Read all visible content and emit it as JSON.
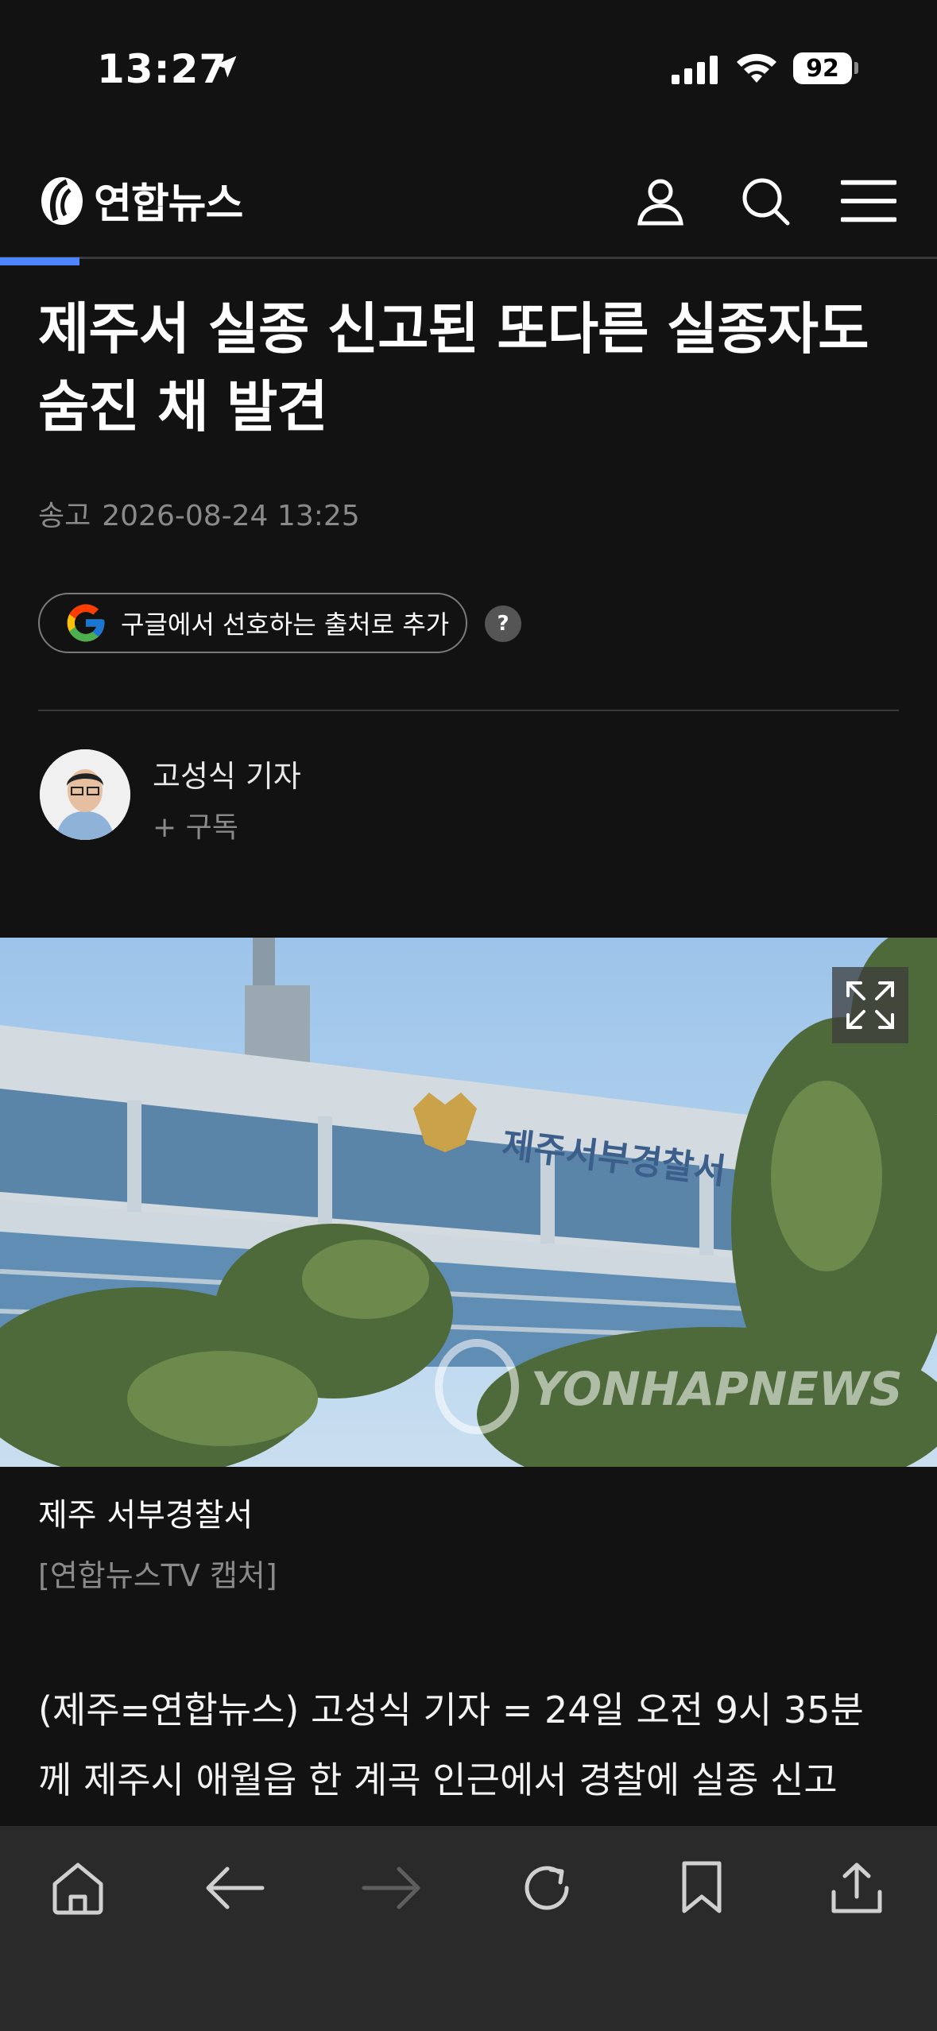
{
  "status_bar": {
    "time": "13:27",
    "battery": "92"
  },
  "header": {
    "logo_text": "연합뉴스"
  },
  "article": {
    "title": "제주서 실종 신고된 또다른 실종자도 숨진 채 발견",
    "sent_label": "송고",
    "sent_time": "2026-08-24 13:25",
    "google_button": "구글에서 선호하는 출처로 추가",
    "help": "?",
    "reporter_name": "고성식 기자",
    "subscribe": "+ 구독",
    "photo_watermark": "YONHAPNEWS",
    "photo_sign": "제주서부경찰서",
    "caption": "제주 서부경찰서",
    "credit": "[연합뉴스TV 캡처]",
    "body_line1": "(제주=연합뉴스) 고성식 기자 = 24일 오전 9시 35분",
    "body_line2": "께 제주시 애월읍 한 계곡 인근에서 경찰에 실종 신고"
  },
  "colors": {
    "accent": "#4d84ff",
    "background": "#121212",
    "toolbar": "#2a2a2a"
  },
  "icons": [
    "location-arrow-icon",
    "signal-icon",
    "wifi-icon",
    "user-icon",
    "search-icon",
    "menu-icon",
    "google-icon",
    "expand-icon",
    "home-icon",
    "back-icon",
    "forward-icon",
    "reload-icon",
    "bookmark-icon",
    "share-icon"
  ]
}
